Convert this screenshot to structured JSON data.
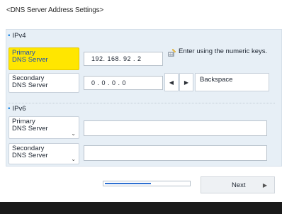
{
  "header": {
    "title": "<DNS Server Address Settings>"
  },
  "ipv4": {
    "section_label": "IPv4",
    "primary": {
      "label": "Primary\nDNS Server",
      "value": "192. 168. 92 . 2"
    },
    "secondary": {
      "label": "Secondary\nDNS Server",
      "value": "0  . 0  . 0  . 0"
    }
  },
  "hint": {
    "text": "Enter using the numeric keys.",
    "icon": "keypad-hand-icon"
  },
  "controls": {
    "left_arrow": "◀",
    "right_arrow": "▶",
    "backspace_label": "Backspace"
  },
  "ipv6": {
    "section_label": "IPv6",
    "primary": {
      "label": "Primary\nDNS Server",
      "value": ""
    },
    "secondary": {
      "label": "Secondary\nDNS Server",
      "value": ""
    }
  },
  "footer": {
    "next_label": "Next",
    "next_arrow": "▶",
    "progress_fraction": 0.55
  },
  "colors": {
    "accent": "#2c6fd1",
    "selected": "#ffe600",
    "panel": "#e7eff6"
  }
}
